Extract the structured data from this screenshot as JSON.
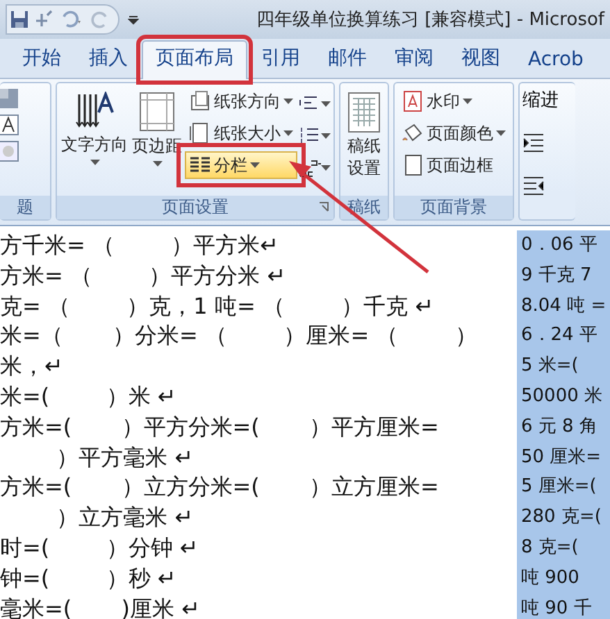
{
  "window": {
    "title": "四年级单位换算练习 [兼容模式] - Microsof"
  },
  "tabs": [
    {
      "label": "开始",
      "selected": false,
      "highlighted": false
    },
    {
      "label": "插入",
      "selected": false,
      "highlighted": false
    },
    {
      "label": "页面布局",
      "selected": true,
      "highlighted": true
    },
    {
      "label": "引用",
      "selected": false,
      "highlighted": false
    },
    {
      "label": "邮件",
      "selected": false,
      "highlighted": false
    },
    {
      "label": "审阅",
      "selected": false,
      "highlighted": false
    },
    {
      "label": "视图",
      "selected": false,
      "highlighted": false
    },
    {
      "label": "Acrob",
      "selected": false,
      "highlighted": false
    }
  ],
  "ribbon": {
    "groups": [
      {
        "kind": "theme",
        "label": "题"
      },
      {
        "kind": "page_setup",
        "label": "页面设置",
        "large": [
          {
            "label": "文字方向"
          },
          {
            "label": "页边距"
          }
        ],
        "small": [
          {
            "label": "纸张方向",
            "selected": false,
            "highlighted": false
          },
          {
            "label": "纸张大小",
            "selected": false,
            "highlighted": false
          },
          {
            "label": "分栏",
            "selected": true,
            "highlighted": true
          }
        ]
      },
      {
        "kind": "paper",
        "label": "稿纸",
        "large": [
          {
            "label": "稿纸设置"
          }
        ]
      },
      {
        "kind": "background",
        "label": "页面背景",
        "small": [
          {
            "label": "水印"
          },
          {
            "label": "页面颜色"
          },
          {
            "label": "页面边框"
          }
        ]
      },
      {
        "kind": "paragraph",
        "heading": "缩进"
      }
    ]
  },
  "document": {
    "left_lines": [
      "方千米= （        ）平方米↵",
      "方米= （        ）平方分米 ↵",
      "克= （        ）克，1 吨= （        ）千克 ↵",
      "米=（       ）分米= （        ）厘米= （        ）",
      "米，↵",
      "米=(        ）米 ↵",
      "方米=(       ）平方分米=(       ）平方厘米=",
      "        ）平方毫米 ↵",
      "方米=(       ）立方分米=(       ）立方厘米=",
      "        ）立方毫米 ↵",
      "时=(        ）分钟 ↵",
      "钟=(        ）秒 ↵",
      "毫米=(       )厘米 ↵"
    ],
    "right_lines": [
      "0．06 平",
      "9 千克 7",
      "8.04 吨 =",
      "6．24 平",
      "5 米=(",
      "50000 米",
      "6 元 8 角",
      "50 厘米=",
      "5 厘米=(",
      "280 克=(",
      "8 克=(",
      "吨 900",
      "吨 90 千"
    ],
    "right_selected": true
  }
}
